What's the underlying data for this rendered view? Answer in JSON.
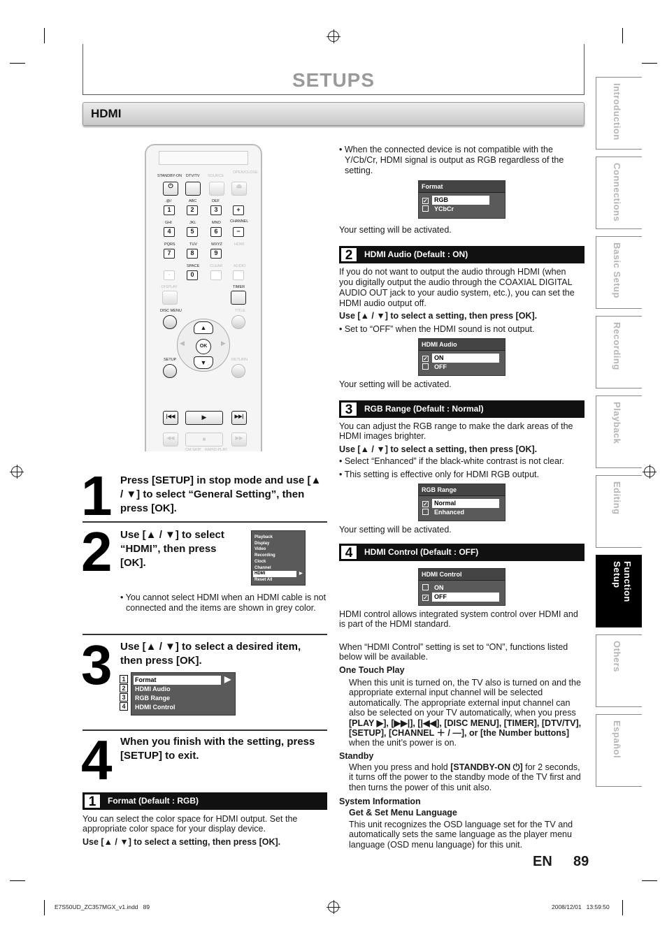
{
  "page": {
    "title": "SETUPS",
    "section": "HDMI",
    "language": "EN",
    "page_number": "89"
  },
  "tabs": [
    {
      "label": "Introduction",
      "active": false
    },
    {
      "label": "Connections",
      "active": false
    },
    {
      "label": "Basic Setup",
      "active": false
    },
    {
      "label": "Recording",
      "active": false
    },
    {
      "label": "Playback",
      "active": false
    },
    {
      "label": "Editing",
      "active": false
    },
    {
      "label": "Function Setup",
      "active": true
    },
    {
      "label": "Others",
      "active": false
    },
    {
      "label": "Español",
      "active": false
    }
  ],
  "remote": {
    "top_labels": [
      "STANDBY-ON",
      "DTV/TV",
      "SOURCE",
      "OPEN/CLOSE"
    ],
    "keys": [
      {
        "label": "1",
        "sub": ".@/:"
      },
      {
        "label": "2",
        "sub": "ABC"
      },
      {
        "label": "3",
        "sub": "DEF"
      },
      {
        "label": "4",
        "sub": "GHI"
      },
      {
        "label": "5",
        "sub": "JKL"
      },
      {
        "label": "6",
        "sub": "MNO"
      },
      {
        "label": "7",
        "sub": "PQRS"
      },
      {
        "label": "8",
        "sub": "TUV"
      },
      {
        "label": "9",
        "sub": "WXYZ"
      },
      {
        "label": "0",
        "sub": "SPACE"
      }
    ],
    "channel_label": "CHANNEL",
    "hdmi_label": "HDMI",
    "clear_label": "CLEAR",
    "audio_label": "AUDIO",
    "display_label": "DISPLAY",
    "timer_label": "TIMER",
    "disc_menu_label": "DISC MENU",
    "title_label": "TITLE",
    "setup_label": "SETUP",
    "return_label": "RETURN",
    "ok_label": "OK",
    "cm_skip_label": "CM SKIP",
    "rapid_play_label": "RAPID PLAY"
  },
  "steps": [
    {
      "num": "1",
      "text": "Press [SETUP] in stop mode and use [▲ / ▼] to select “General Setting”, then press [OK]."
    },
    {
      "num": "2",
      "text": "Use [▲ / ▼] to select “HDMI”, then press [OK].",
      "note": "• You cannot select HDMI when an HDMI cable is not connected and the items are shown in grey color."
    },
    {
      "num": "3",
      "text": "Use [▲ / ▼] to select a desired item, then press [OK]."
    },
    {
      "num": "4",
      "text": "When you finish with the setting, press [SETUP] to exit."
    }
  ],
  "general_menu": {
    "items": [
      "Playback",
      "Display",
      "Video",
      "Recording",
      "Clock",
      "Channel",
      "HDMI",
      "Reset All"
    ],
    "selected": "HDMI"
  },
  "hdmi_menu": {
    "items": [
      {
        "num": "1",
        "label": "Format"
      },
      {
        "num": "2",
        "label": "HDMI Audio"
      },
      {
        "num": "3",
        "label": "RGB Range"
      },
      {
        "num": "4",
        "label": "HDMI Control"
      }
    ],
    "selected": "Format"
  },
  "sections": {
    "format": {
      "num": "1",
      "title": "Format (Default : RGB)",
      "desc": "You can select the color space for HDMI output. Set the appropriate color space for your display device.",
      "instruction": "Use [▲ / ▼] to select a setting, then press [OK].",
      "note": "• When the connected device is not compatible with the Y/Cb/Cr, HDMI signal is output as RGB regardless of the setting.",
      "menu": {
        "header": "Format",
        "options": [
          {
            "label": "RGB",
            "checked": true
          },
          {
            "label": "YCbCr",
            "checked": false
          }
        ]
      },
      "result": "Your setting will be activated."
    },
    "hdmi_audio": {
      "num": "2",
      "title": "HDMI Audio (Default : ON)",
      "desc": "If you do not want to output the audio through HDMI (when you digitally output the audio through the COAXIAL DIGITAL AUDIO OUT jack to your audio system, etc.), you can set the HDMI audio output off.",
      "instruction": "Use [▲ / ▼] to select a setting, then press [OK].",
      "note": "• Set to “OFF” when the HDMI sound is not output.",
      "menu": {
        "header": "HDMI Audio",
        "options": [
          {
            "label": "ON",
            "checked": true
          },
          {
            "label": "OFF",
            "checked": false
          }
        ]
      },
      "result": "Your setting will be activated."
    },
    "rgb_range": {
      "num": "3",
      "title": "RGB Range (Default : Normal)",
      "desc": "You can adjust the RGB range to make the dark areas of the HDMI images brighter.",
      "instruction": "Use [▲ / ▼] to select a setting, then press [OK].",
      "notes": [
        "• Select “Enhanced” if the black-white contrast is not clear.",
        "• This setting is effective only for HDMI RGB output."
      ],
      "menu": {
        "header": "RGB Range",
        "options": [
          {
            "label": "Normal",
            "checked": true
          },
          {
            "label": "Enhanced",
            "checked": false
          }
        ]
      },
      "result": "Your setting will be activated."
    },
    "hdmi_control": {
      "num": "4",
      "title": "HDMI Control (Default : OFF)",
      "menu": {
        "header": "HDMI Control",
        "options": [
          {
            "label": "ON",
            "checked": false
          },
          {
            "label": "OFF",
            "checked": true
          }
        ]
      },
      "desc": "HDMI control allows integrated system control over HDMI and is part of the HDMI standard.",
      "desc2": "When “HDMI Control” setting is set to “ON”, functions listed below will be available.",
      "one_touch_title": "One Touch Play",
      "one_touch_text_a": "When this unit is turned on, the TV also is turned on and the appropriate external input channel will be selected automatically. The appropriate external input channel can also be selected on your TV automatically, when you press ",
      "one_touch_bold": "[PLAY ▶], [▶▶|], [|◀◀], [DISC MENU], [TIMER], [DTV/TV], [SETUP], [CHANNEL ＋ / —], or [the Number buttons]",
      "one_touch_text_b": " when the unit’s power is on.",
      "standby_title": "Standby",
      "standby_text_a": "When you press and hold ",
      "standby_bold": "[STANDBY-ON ⏻]",
      "standby_text_b": " for 2 seconds, it turns off the power to the standby mode of the TV first and then turns the power of this unit also.",
      "sysinfo_title": "System Information",
      "sysinfo_sub": "Get & Set Menu Language",
      "sysinfo_text": "This unit recognizes the OSD language set for the TV and automatically sets the same language as the player menu language (OSD menu language) for this unit."
    }
  },
  "footer": {
    "file": "E7S50UD_ZC357MGX_v1.indd   89",
    "date": "2008/12/01   13:59:50"
  }
}
